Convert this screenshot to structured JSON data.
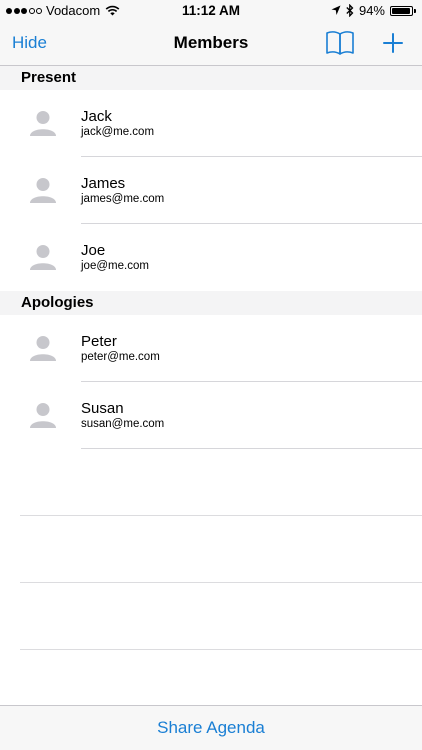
{
  "status_bar": {
    "carrier": "Vodacom",
    "signal_bars": 3,
    "signal_total": 5,
    "time": "11:12 AM",
    "battery_percent": "94%",
    "battery_level": 0.94,
    "icons": [
      "wifi-icon",
      "location-arrow-icon",
      "bluetooth-icon",
      "battery-icon"
    ]
  },
  "nav": {
    "left_button": "Hide",
    "title": "Members",
    "right_icons": [
      "book-icon",
      "plus-icon"
    ]
  },
  "sections": [
    {
      "title": "Present",
      "members": [
        {
          "name": "Jack",
          "email": "jack@me.com"
        },
        {
          "name": "James",
          "email": "james@me.com"
        },
        {
          "name": "Joe",
          "email": "joe@me.com"
        }
      ]
    },
    {
      "title": "Apologies",
      "members": [
        {
          "name": "Peter",
          "email": "peter@me.com"
        },
        {
          "name": "Susan",
          "email": "susan@me.com"
        }
      ]
    }
  ],
  "toolbar": {
    "share_label": "Share Agenda"
  },
  "colors": {
    "accent": "#1a7fd4",
    "bar_background": "#f7f7f7",
    "section_background": "#f4f4f5",
    "avatar_gray": "#c7c7cc"
  }
}
